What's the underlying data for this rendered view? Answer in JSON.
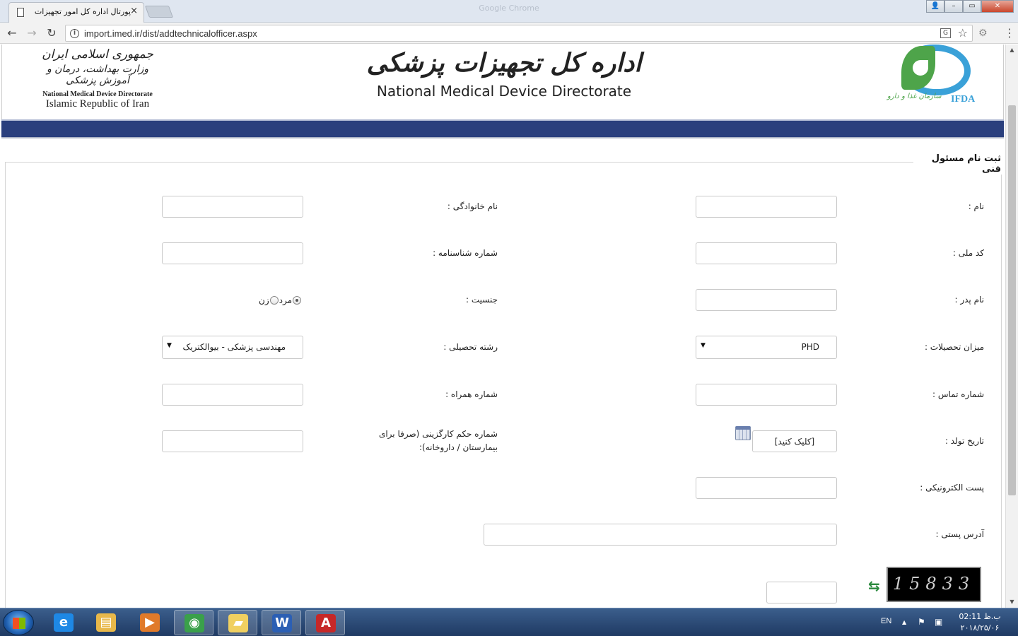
{
  "browser": {
    "tab_title": "پورتال اداره کل امور تجهیزات و",
    "tab_close": "×",
    "window_title": "Google Chrome",
    "url": "import.imed.ir/dist/addtechnicalofficer.aspx",
    "window_buttons": {
      "account": "👤",
      "minimize": "–",
      "maximize": "▭",
      "close": "✕"
    },
    "nav": {
      "back": "←",
      "forward": "→",
      "reload": "↻"
    },
    "icons": {
      "info": "i",
      "translate": "G",
      "star": "☆",
      "extension": "⚙",
      "menu": "⋮"
    }
  },
  "header": {
    "left_logo": {
      "fa_line1": "جمهوری اسلامی ایران",
      "fa_line2": "وزارت بهداشت، درمان و آموزش پزشکی",
      "en_line1": "National Medical Device Directorate",
      "en_line2": "Islamic Republic of Iran"
    },
    "title_fa": "اداره کل تجهیزات پزشکی",
    "title_en": "National Medical Device Directorate",
    "right_logo": {
      "en": "IFDA",
      "fa": "سازمان غذا و دارو"
    }
  },
  "form": {
    "legend": "ثبت نام مسئول فنی",
    "labels": {
      "first_name": "نام :",
      "last_name": "نام خانوادگی :",
      "national_code": "کد ملی :",
      "id_number": "شماره شناسنامه :",
      "father_name": "نام پدر :",
      "gender": "جنسیت :",
      "education_level": "میزان تحصیلات :",
      "field_of_study": "رشته تحصیلی :",
      "phone": "شماره تماس :",
      "mobile": "شماره همراه :",
      "birth_date": "تاریخ تولد :",
      "employment_order": "شماره حکم کارگزینی (صرفا برای بیمارستان / داروخانه):",
      "email": "پست الکترونیکی :",
      "postal_address": "آدرس پستی :"
    },
    "gender_options": {
      "male": "مرد",
      "female": "زن",
      "selected": "male"
    },
    "education_level_value": "PHD",
    "field_of_study_value": "مهندسی پزشکی - بیوالکتریک",
    "select_arrow": "▼",
    "birth_date_value": "[کلیک کنید]",
    "captcha_text": "15833",
    "refresh_glyph": "⇆"
  },
  "taskbar": {
    "apps": [
      {
        "name": "ie",
        "glyph": "e",
        "color": "#1e88e5"
      },
      {
        "name": "explorer",
        "glyph": "▤",
        "color": "#e8b84a"
      },
      {
        "name": "media",
        "glyph": "▶",
        "color": "#e07a2a"
      },
      {
        "name": "chrome",
        "glyph": "◉",
        "color": "#3aa04a"
      },
      {
        "name": "folder",
        "glyph": "▰",
        "color": "#f0d060"
      },
      {
        "name": "word",
        "glyph": "W",
        "color": "#2b5fb4"
      },
      {
        "name": "acrobat",
        "glyph": "A",
        "color": "#c62828"
      }
    ],
    "lang": "EN",
    "tray_glyphs": {
      "up": "▲",
      "flag": "⚑",
      "network": "▣"
    },
    "clock_time": "ب.ظ 02:11",
    "clock_date": "۲۰۱۸/۲۵/۰۶"
  }
}
